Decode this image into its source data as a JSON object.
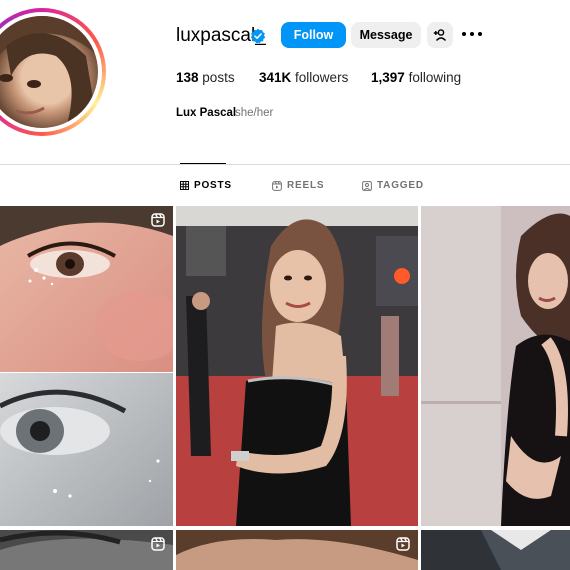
{
  "profile": {
    "username": "luxpascal_",
    "verified": true,
    "full_name": "Lux Pascal",
    "pronouns": "she/her"
  },
  "actions": {
    "follow_label": "Follow",
    "message_label": "Message"
  },
  "stats": {
    "posts_count": "138",
    "posts_label": "posts",
    "followers_count": "341K",
    "followers_label": "followers",
    "following_count": "1,397",
    "following_label": "following"
  },
  "tabs": [
    {
      "label": "POSTS",
      "icon": "grid-icon",
      "active": true
    },
    {
      "label": "REELS",
      "icon": "reels-icon",
      "active": false
    },
    {
      "label": "TAGGED",
      "icon": "tagged-icon",
      "active": false
    }
  ],
  "colors": {
    "accent": "#0095f6",
    "button_secondary": "#efefef",
    "divider": "#dbdbdb",
    "muted_text": "#737373"
  }
}
